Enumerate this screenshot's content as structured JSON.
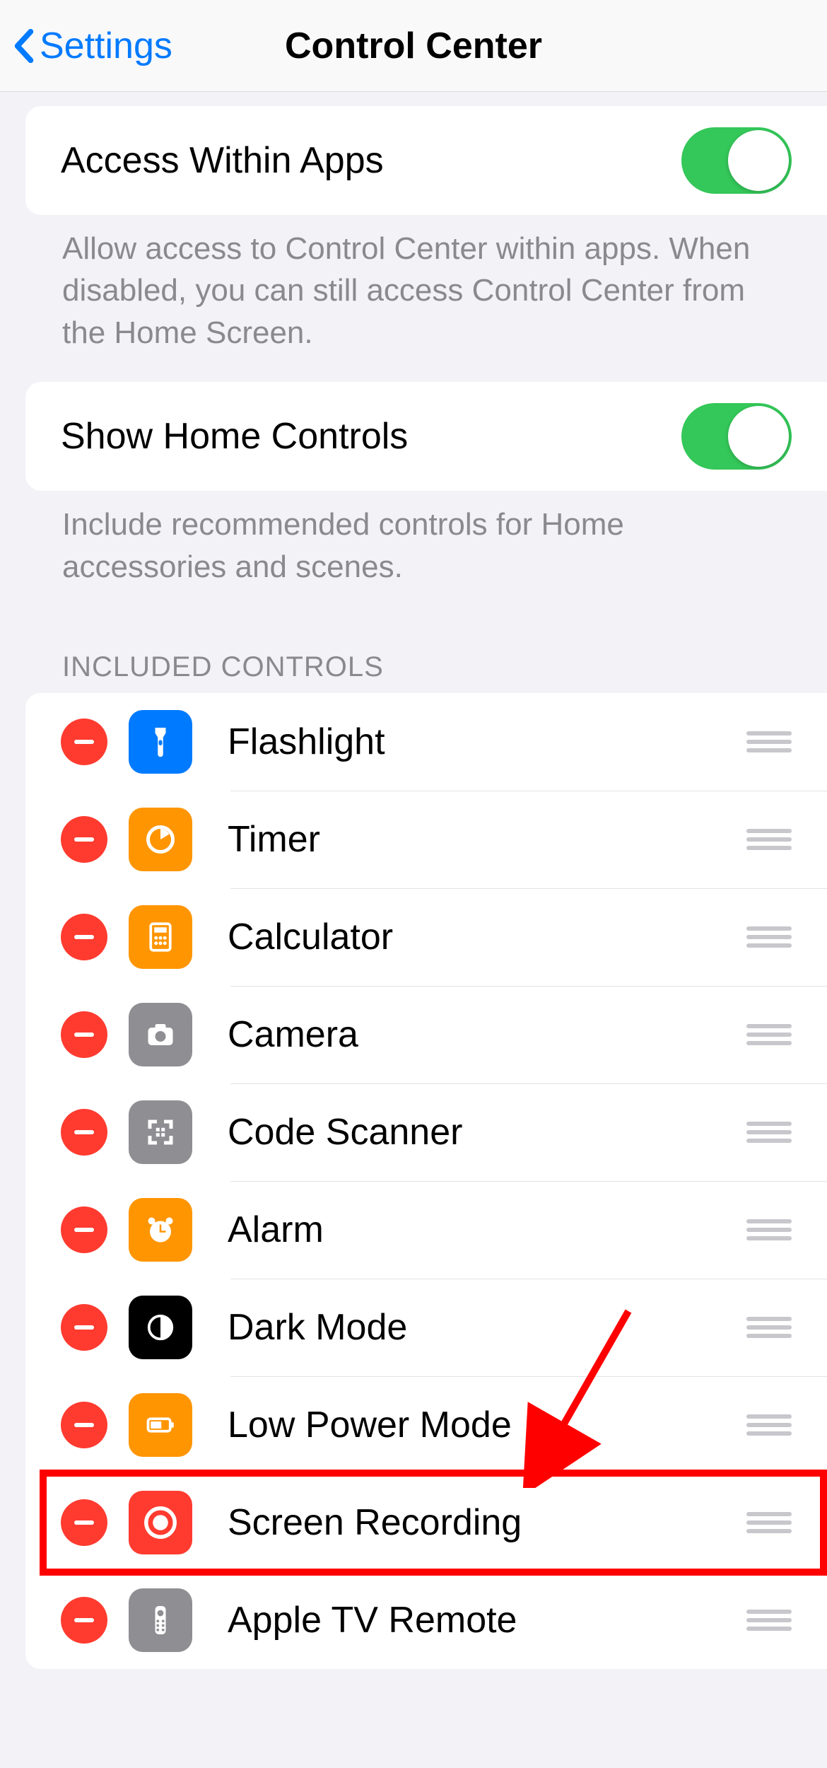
{
  "navbar": {
    "back_label": "Settings",
    "title": "Control Center"
  },
  "section1": {
    "access_label": "Access Within Apps",
    "access_on": true,
    "access_footer": "Allow access to Control Center within apps. When disabled, you can still access Control Center from the Home Screen."
  },
  "section2": {
    "home_label": "Show Home Controls",
    "home_on": true,
    "home_footer": "Include recommended controls for Home accessories and scenes."
  },
  "included": {
    "header": "INCLUDED CONTROLS",
    "items": [
      {
        "label": "Flashlight",
        "icon": "flashlight",
        "color": "#007aff"
      },
      {
        "label": "Timer",
        "icon": "timer",
        "color": "#ff9500"
      },
      {
        "label": "Calculator",
        "icon": "calculator",
        "color": "#ff9500"
      },
      {
        "label": "Camera",
        "icon": "camera",
        "color": "#8e8e93"
      },
      {
        "label": "Code Scanner",
        "icon": "qrcode",
        "color": "#8e8e93"
      },
      {
        "label": "Alarm",
        "icon": "alarm",
        "color": "#ff9500"
      },
      {
        "label": "Dark Mode",
        "icon": "darkmode",
        "color": "#000000"
      },
      {
        "label": "Low Power Mode",
        "icon": "battery",
        "color": "#ff9500"
      },
      {
        "label": "Screen Recording",
        "icon": "record",
        "color": "#ff3b30"
      },
      {
        "label": "Apple TV Remote",
        "icon": "remote",
        "color": "#8e8e93"
      }
    ]
  },
  "annotation": {
    "highlight_index": 8,
    "arrow": true
  }
}
